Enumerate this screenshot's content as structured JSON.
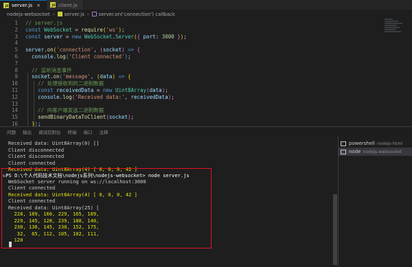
{
  "tabs": [
    {
      "label": "server.js",
      "active": true,
      "close": "×"
    },
    {
      "label": "client.js",
      "active": false,
      "close": ""
    }
  ],
  "breadcrumb": {
    "folder": "nodejs-websocket",
    "file": "server.js",
    "symbol": "server.on('connection') callback"
  },
  "editor": {
    "lines": [
      {
        "n": "1",
        "html": "<span class=\"c-comment\">// server.js</span>"
      },
      {
        "n": "2",
        "html": "<span class=\"c-kw\">const</span> <span class=\"c-cls\">WebSocket</span> = <span class=\"c-fn\">require</span><span class=\"c-brace\">(</span><span class=\"c-str\">'ws'</span><span class=\"c-brace\">)</span>;"
      },
      {
        "n": "3",
        "html": "<span class=\"c-kw\">const</span> <span class=\"c-var\">server</span> = <span class=\"c-kw\">new</span> <span class=\"c-cls\">WebSocket</span>.<span class=\"c-cls\">Server</span><span class=\"c-brace\">(</span><span class=\"c-paren\">{</span> <span class=\"c-var\">port</span>: <span class=\"c-num\">3000</span> <span class=\"c-paren\">}</span><span class=\"c-brace\">)</span>;"
      },
      {
        "n": "4",
        "html": ""
      },
      {
        "n": "5",
        "html": "<span class=\"c-var\">server</span>.<span class=\"c-fn\">on</span><span class=\"c-brace\">(</span><span class=\"c-str\">'connection'</span>, <span class=\"c-paren\">(</span><span class=\"c-var\">socket</span><span class=\"c-paren\">)</span> <span class=\"c-kw\">=&gt;</span> <span class=\"c-paren\">{</span>"
      },
      {
        "n": "6",
        "html": "  <span class=\"c-var\">console</span>.<span class=\"c-fn\">log</span><span class=\"c-kw\">(</span><span class=\"c-str\">'Client connected'</span><span class=\"c-kw\">)</span>;"
      },
      {
        "n": "7",
        "html": ""
      },
      {
        "n": "8",
        "html": "  <span class=\"c-comment\">// 监听消息事件</span>"
      },
      {
        "n": "9",
        "html": "  <span class=\"c-var\">socket</span>.<span class=\"c-fn\">on</span><span class=\"c-kw\">(</span><span class=\"c-str\">'message'</span>, <span class=\"c-brace\">(</span><span class=\"c-var\">data</span><span class=\"c-brace\">)</span> <span class=\"c-kw\">=&gt;</span> <span class=\"c-brace\">{</span>"
      },
      {
        "n": "10",
        "html": "    <span class=\"c-comment\">// 处理接收到的二进制数据</span>"
      },
      {
        "n": "11",
        "html": "    <span class=\"c-kw\">const</span> <span class=\"c-var\">receivedData</span> = <span class=\"c-kw\">new</span> <span class=\"c-cls\">Uint8Array</span><span class=\"c-paren\">(</span><span class=\"c-var\">data</span><span class=\"c-paren\">)</span>;"
      },
      {
        "n": "12",
        "html": "    <span class=\"c-var\">console</span>.<span class=\"c-fn\">log</span><span class=\"c-paren\">(</span><span class=\"c-str\">'Received data:'</span>, <span class=\"c-var\">receivedData</span><span class=\"c-paren\">)</span>;"
      },
      {
        "n": "13",
        "html": ""
      },
      {
        "n": "14",
        "html": "    <span class=\"c-comment\">// 向客户端发送二进制数据</span>"
      },
      {
        "n": "15",
        "html": "    <span class=\"c-fn\">sendBinaryDataToClient</span><span class=\"c-paren\">(</span><span class=\"c-var\">socket</span><span class=\"c-paren\">)</span>;"
      },
      {
        "n": "16",
        "html": "  <span class=\"c-brace\">}</span><span class=\"c-kw\">)</span>;"
      }
    ]
  },
  "panel": {
    "tabs": [
      "问题",
      "输出",
      "调试控制台",
      "终端",
      "端口",
      "注释"
    ]
  },
  "terminal": {
    "lines": [
      {
        "text": "Received data: Uint8Array(0) []",
        "style": ""
      },
      {
        "text": "Client disconnected",
        "style": ""
      },
      {
        "text": "Client disconnected",
        "style": ""
      },
      {
        "text": "Client connected",
        "style": ""
      },
      {
        "text": "Received data: Uint8Array(4) [ 0, 0, 0, 42 ]",
        "style": "yellow"
      },
      {
        "text": "PS D:\\个人代码技术文档\\nodejs系列\\nodejs-websocket> node server.js",
        "style": "ps"
      },
      {
        "text": "WebSocket server running on ws://localhost:3000",
        "style": ""
      },
      {
        "text": "Client connected",
        "style": ""
      },
      {
        "text": "Received data: Uint8Array(4) [ 0, 0, 0, 42 ]",
        "style": "yellow"
      },
      {
        "text": "Client connected",
        "style": ""
      },
      {
        "text": "Received data: Uint8Array(25) [",
        "style": ""
      },
      {
        "text": "  228, 189, 160, 229, 165, 189,",
        "style": "yellow"
      },
      {
        "text": "  229, 145, 128, 239, 188, 140,",
        "style": "yellow"
      },
      {
        "text": "  230, 136, 145, 230, 152, 175,",
        "style": "yellow"
      },
      {
        "text": "   32,  65, 112, 105, 102, 111,",
        "style": "yellow"
      },
      {
        "text": "  120",
        "style": "yellow"
      },
      {
        "text": "]",
        "style": ""
      }
    ]
  },
  "terminal_list": [
    {
      "name": "powershell",
      "sub": "nodejs-html",
      "active": false
    },
    {
      "name": "node",
      "sub": "nodejs-websocket",
      "active": true
    }
  ]
}
